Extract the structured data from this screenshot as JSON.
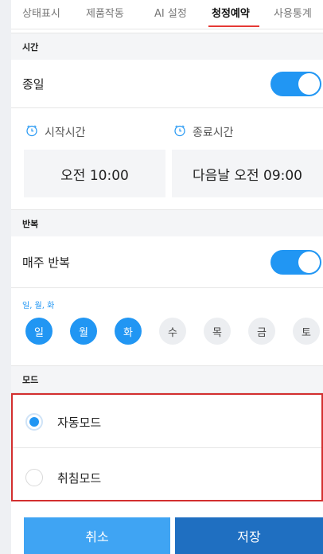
{
  "tabs": [
    {
      "label": "상태표시"
    },
    {
      "label": "제품작동"
    },
    {
      "label": "AI 설정"
    },
    {
      "label": "청정예약",
      "active": true
    },
    {
      "label": "사용통계"
    }
  ],
  "time_section": {
    "header": "시간",
    "all_day_label": "종일",
    "all_day_on": true,
    "start_label": "시작시간",
    "end_label": "종료시간",
    "start_value": "오전 10:00",
    "end_value": "다음날 오전 09:00"
  },
  "repeat_section": {
    "header": "반복",
    "weekly_label": "매주 반복",
    "weekly_on": true,
    "selected_caption": "일, 월, 화",
    "days": [
      {
        "label": "일",
        "selected": true
      },
      {
        "label": "월",
        "selected": true
      },
      {
        "label": "화",
        "selected": true
      },
      {
        "label": "수",
        "selected": false
      },
      {
        "label": "목",
        "selected": false
      },
      {
        "label": "금",
        "selected": false
      },
      {
        "label": "토",
        "selected": false
      }
    ]
  },
  "mode_section": {
    "header": "모드",
    "options": [
      {
        "label": "자동모드",
        "checked": true
      },
      {
        "label": "취침모드",
        "checked": false
      }
    ]
  },
  "actions": {
    "cancel_label": "취소",
    "save_label": "저장"
  },
  "colors": {
    "accent": "#2196f3",
    "tab_underline": "#e53935",
    "highlight_border": "#d32f2f",
    "save_button": "#1f6fc1",
    "cancel_button": "#3fa4f3"
  },
  "icons": {
    "time_icon": "alarm-clock-icon"
  }
}
